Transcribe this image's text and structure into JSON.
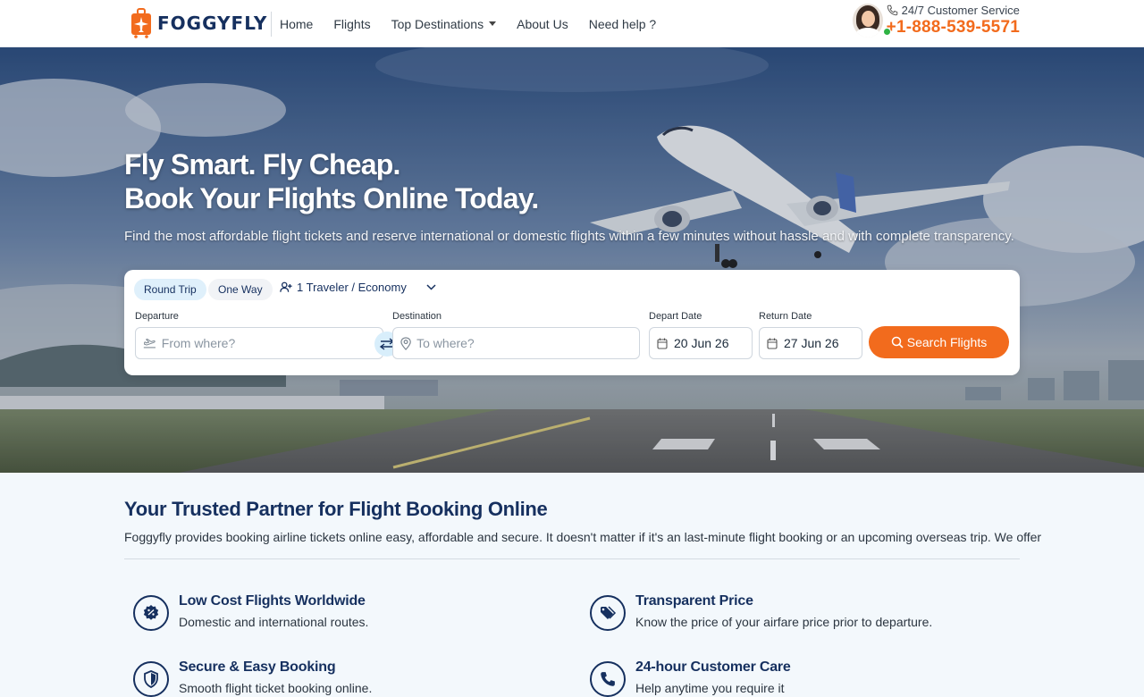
{
  "brand": {
    "name": "FOGGYFLY",
    "accent": "#f26b1d",
    "navy": "#16305f"
  },
  "nav": {
    "items": [
      "Home",
      "Flights",
      "Top Destinations",
      "About Us",
      "Need help ?"
    ]
  },
  "support": {
    "label": "24/7 Customer Service",
    "phone": "+1-888-539-5571"
  },
  "hero": {
    "title_line1": "Fly Smart. Fly Cheap.",
    "title_line2": "Book Your Flights Online Today.",
    "subtitle": "Find the most affordable flight tickets and reserve international or domestic flights within a few minutes without hassle and with complete transparency."
  },
  "search": {
    "trip_round": "Round Trip",
    "trip_oneway": "One Way",
    "traveler": "1 Traveler / Economy",
    "departure_label": "Departure",
    "departure_placeholder": "From where?",
    "destination_label": "Destination",
    "destination_placeholder": "To where?",
    "depart_date_label": "Depart Date",
    "depart_date": "20 Jun 26",
    "return_date_label": "Return Date",
    "return_date": "27 Jun 26",
    "button": "Search Flights"
  },
  "content": {
    "title": "Your Trusted Partner for Flight Booking Online",
    "text": "Foggyfly provides booking airline tickets online easy, affordable and secure. It doesn't matter if it's an last-minute flight booking or an upcoming overseas trip. We offer",
    "features": [
      {
        "title": "Low Cost Flights Worldwide",
        "desc": "Domestic and international routes.",
        "icon": "discount-badge-icon"
      },
      {
        "title": "Transparent Price",
        "desc": "Know the price of your airfare price prior to departure.",
        "icon": "price-tag-icon"
      },
      {
        "title": "Secure & Easy Booking",
        "desc": "Smooth flight ticket booking online.",
        "icon": "shield-icon"
      },
      {
        "title": "24-hour Customer Care",
        "desc": "Help anytime you require it",
        "icon": "phone-icon"
      }
    ]
  }
}
